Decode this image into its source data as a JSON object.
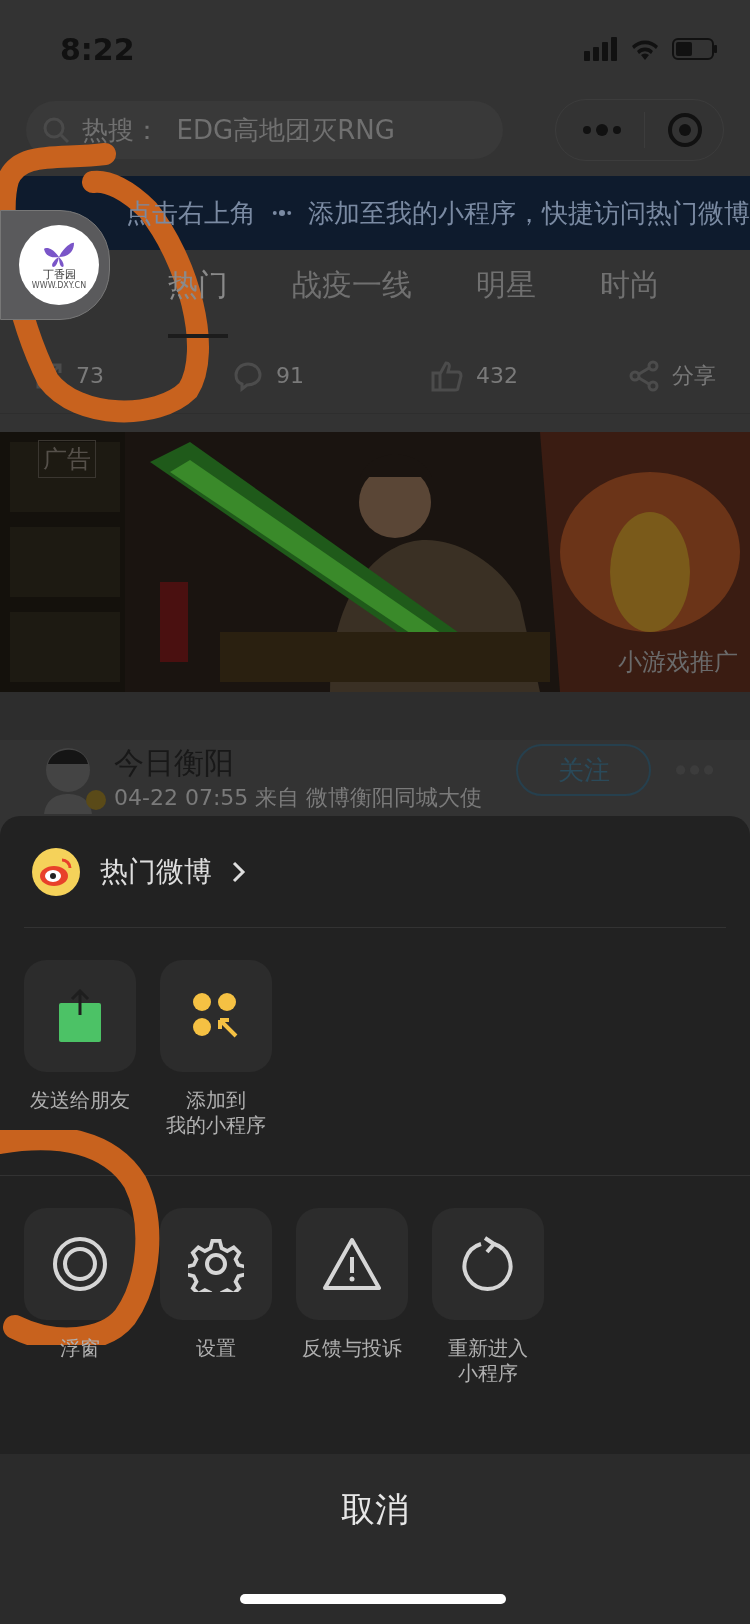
{
  "status_bar": {
    "time": "8:22"
  },
  "search": {
    "placeholder": "热搜：  EDG高地团灭RNG"
  },
  "banner": {
    "text_before": "点击右上角",
    "text_after": "添加至我的小程序，快捷访问热门微博"
  },
  "tabs": [
    {
      "label": "热门",
      "selected": true
    },
    {
      "label": "战疫一线",
      "selected": false
    },
    {
      "label": "明星",
      "selected": false
    },
    {
      "label": "时尚",
      "selected": false
    }
  ],
  "stats": [
    {
      "kind": "repost",
      "label": "73"
    },
    {
      "kind": "comment",
      "label": "91"
    },
    {
      "kind": "like",
      "label": "432"
    },
    {
      "kind": "share",
      "label": "分享"
    }
  ],
  "ad": {
    "kind": "picture",
    "badge": "广告",
    "source": "小游戏推广"
  },
  "post": {
    "author": "今日衡阳",
    "meta": "04-22 07:55 来自 微博衡阳同城大使",
    "follow": "关注",
    "verified": true
  },
  "floating_window": {
    "name": "丁香园",
    "url": "WWW.DXY.CN"
  },
  "sheet": {
    "app_name": "热门微博",
    "rows": [
      [
        {
          "kind": "send",
          "lines": [
            "发送给朋友"
          ]
        },
        {
          "kind": "add",
          "lines": [
            "添加到",
            "我的小程序"
          ]
        }
      ],
      [
        {
          "kind": "float",
          "lines": [
            "浮窗"
          ]
        },
        {
          "kind": "settings",
          "lines": [
            "设置"
          ]
        },
        {
          "kind": "feedback",
          "lines": [
            "反馈与投诉"
          ]
        },
        {
          "kind": "reload",
          "lines": [
            "重新进入",
            "小程序"
          ]
        }
      ]
    ],
    "cancel": "取消"
  }
}
